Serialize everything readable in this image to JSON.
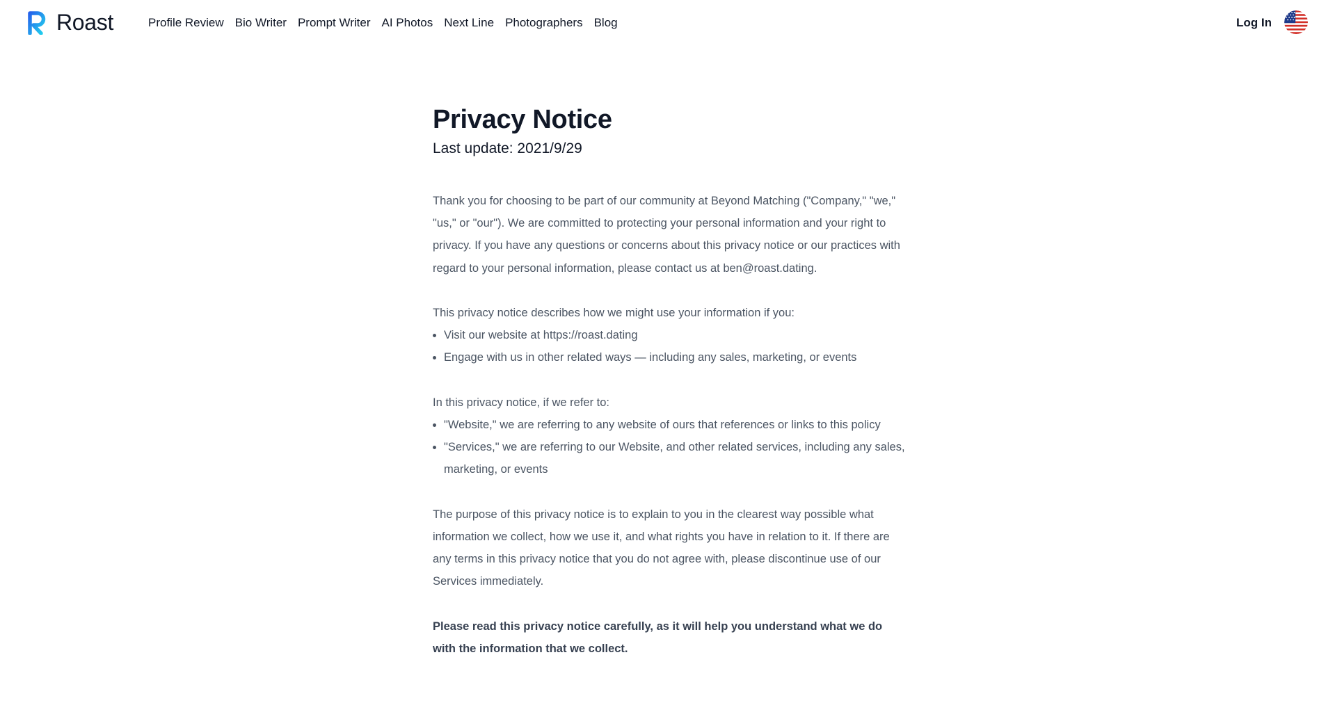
{
  "header": {
    "brand": "Roast",
    "nav": [
      {
        "label": "Profile Review"
      },
      {
        "label": "Bio Writer"
      },
      {
        "label": "Prompt Writer"
      },
      {
        "label": "AI Photos"
      },
      {
        "label": "Next Line"
      },
      {
        "label": "Photographers"
      },
      {
        "label": "Blog"
      }
    ],
    "login_label": "Log In",
    "language_icon": "us-flag-icon"
  },
  "main": {
    "title": "Privacy Notice",
    "last_update": "Last update: 2021/9/29",
    "intro": "Thank you for choosing to be part of our community at Beyond Matching (\"Company,\" \"we,\" \"us,\" or \"our\"). We are committed to protecting your personal information and your right to privacy. If you have any questions or concerns about this privacy notice or our practices with regard to your personal information, please contact us at ben@roast.dating.",
    "usage_intro": "This privacy notice describes how we might use your information if you:",
    "usage_items": [
      "Visit our website at https://roast.dating",
      "Engage with us in other related ways — including any sales, marketing, or events"
    ],
    "refer_intro": "In this privacy notice, if we refer to:",
    "refer_items": [
      "\"Website,\" we are referring to any website of ours that references or links to this policy",
      "\"Services,\" we are referring to our Website, and other related services, including any sales, marketing, or events"
    ],
    "purpose": "The purpose of this privacy notice is to explain to you in the clearest way possible what information we collect, how we use it, and what rights you have in relation to it. If there are any terms in this privacy notice that you do not agree with, please discontinue use of our Services immediately.",
    "notice_bold": "Please read this privacy notice carefully, as it will help you understand what we do with the information that we collect."
  },
  "colors": {
    "brand_gradient_start": "#3b82f6",
    "brand_gradient_end": "#22d3ee",
    "heading": "#111827",
    "body": "#4b5563"
  }
}
